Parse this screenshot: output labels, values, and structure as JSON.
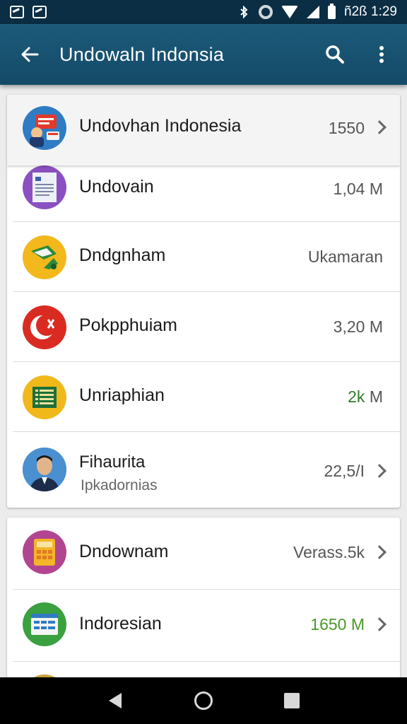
{
  "status_bar": {
    "time": "ñ2ß 1:29",
    "icons": [
      "image-icon",
      "gallery-icon",
      "bluetooth-icon",
      "sync-icon",
      "wifi-icon",
      "signal-icon",
      "battery-icon"
    ]
  },
  "app_bar": {
    "title": "Undowaln Indonsia",
    "icons": [
      "back-arrow-icon",
      "search-icon",
      "overflow-menu-icon"
    ],
    "color": "#1c5a7a"
  },
  "list_card_1": {
    "items": [
      {
        "label": "Undovhan Indonesia",
        "value": "1550",
        "icon": "flag-chat-icon",
        "has_chevron": true
      },
      {
        "label": "Undovain",
        "value": "1,04 M",
        "icon": "document-icon",
        "has_chevron": false
      },
      {
        "label": "Dndgnham",
        "value": "Ukamaran",
        "icon": "garuda-map-icon",
        "has_chevron": false
      },
      {
        "label": "Pokpphuiam",
        "value": "3,20 M",
        "icon": "crescent-icon",
        "has_chevron": false
      },
      {
        "label": "Unriaphian",
        "value": "2k",
        "value_suffix": " M",
        "icon": "ledger-icon",
        "has_chevron": false
      },
      {
        "label": "Fihaurita",
        "sublabel": "Ipkadornias",
        "value": "22,5",
        "value_suffix": "/I",
        "icon": "person-avatar-icon",
        "has_chevron": true
      }
    ]
  },
  "list_card_2": {
    "items": [
      {
        "label": "Dndownam",
        "value": "Verass.5k",
        "icon": "calculator-icon",
        "has_chevron": true
      },
      {
        "label": "Indoresian",
        "value": "1650 M",
        "icon": "table-sheet-icon",
        "has_chevron": true
      }
    ]
  },
  "accent_colors": {
    "positive": "#4a9a2a",
    "appbar": "#1c5a7a",
    "statusbar": "#0b2e44"
  },
  "nav_bar": {
    "icons": [
      "nav-back-icon",
      "nav-home-icon",
      "nav-recents-icon"
    ]
  }
}
